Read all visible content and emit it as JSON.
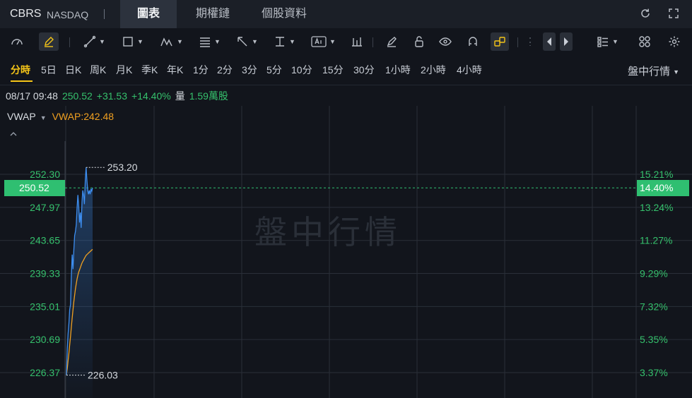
{
  "header": {
    "symbol": "CBRS",
    "exchange": "NASDAQ",
    "tabs": [
      {
        "label": "圖表",
        "active": true
      },
      {
        "label": "期權鏈",
        "active": false
      },
      {
        "label": "個股資料",
        "active": false
      }
    ],
    "icons": [
      "refresh-icon",
      "fullscreen-icon"
    ]
  },
  "toolbar": {
    "icons": [
      "speedometer-icon",
      "pencil-icon",
      "line-tool-icon",
      "rectangle-tool-icon",
      "pattern-tool-icon",
      "fibonacci-tool-icon",
      "arrow-tool-icon",
      "measure-tool-icon",
      "text-tool-icon",
      "bar-icon",
      "brush-icon",
      "unlock-icon",
      "eye-icon",
      "magnet-icon",
      "link-icon",
      "undo-icon",
      "prev-icon",
      "next-icon",
      "layout-icon",
      "grid-icon",
      "settings-icon"
    ]
  },
  "periods": {
    "items": [
      "分時",
      "5日",
      "日K",
      "周K",
      "月K",
      "季K",
      "年K",
      "1分",
      "2分",
      "3分",
      "5分",
      "10分",
      "15分",
      "30分",
      "1小時",
      "2小時",
      "4小時"
    ],
    "active": "分時",
    "mode_label": "盤中行情"
  },
  "info": {
    "datetime": "08/17 09:48",
    "price": "250.52",
    "change": "+31.53",
    "change_pct": "+14.40%",
    "volume_label": "量",
    "volume": "1.59萬股"
  },
  "indicator": {
    "name": "VWAP",
    "value_label": "VWAP:242.48"
  },
  "chart_data": {
    "type": "line",
    "watermark": "盤中行情",
    "y_left_ticks": [
      "252.30",
      "247.97",
      "243.65",
      "239.33",
      "235.01",
      "230.69",
      "226.37"
    ],
    "y_right_ticks": [
      "15.21%",
      "13.24%",
      "11.27%",
      "9.29%",
      "7.32%",
      "5.35%",
      "3.37%"
    ],
    "ylim": [
      223.9,
      256.4
    ],
    "current_price": "250.52",
    "current_pct": "14.40%",
    "high_label": "253.20",
    "low_label": "226.03",
    "series": [
      {
        "name": "price",
        "color": "#3d8ef0",
        "values": [
          226.03,
          229.5,
          231.4,
          232.8,
          234.6,
          235.3,
          238.9,
          241.8,
          239.9,
          242.3,
          244.3,
          244.8,
          245.7,
          247.9,
          249.6,
          248.2,
          246.0,
          247.3,
          245.3,
          248.7,
          250.2,
          249.6,
          248.4,
          251.4,
          253.2,
          251.6,
          250.2,
          249.7,
          250.2,
          249.7,
          250.4,
          250.1,
          250.52
        ]
      },
      {
        "name": "VWAP",
        "color": "#f0a020",
        "values": [
          226.03,
          226.9,
          227.9,
          228.9,
          230.0,
          231.1,
          232.3,
          233.5,
          234.6,
          235.6,
          236.5,
          237.3,
          238.0,
          238.6,
          239.1,
          239.5,
          239.8,
          240.1,
          240.4,
          240.7,
          240.9,
          241.1,
          241.3,
          241.5,
          241.7,
          241.8,
          241.9,
          242.0,
          242.1,
          242.2,
          242.3,
          242.4,
          242.48
        ]
      }
    ]
  }
}
